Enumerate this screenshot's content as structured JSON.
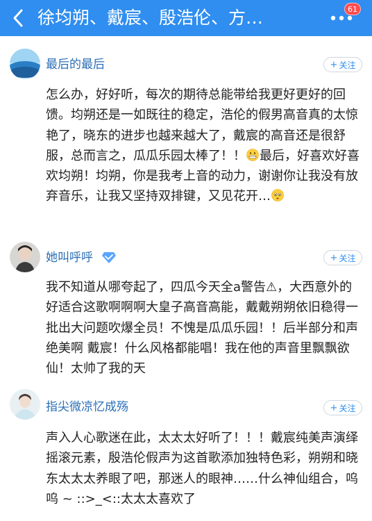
{
  "header": {
    "title": "徐均朔、戴宸、殷浩伦、方…",
    "badge_count": "61",
    "accent_color": "#2f8ef0",
    "back_icon": "chevron-left-icon",
    "more_icon": "more-dots-icon"
  },
  "comments": [
    {
      "username": "最后的最后",
      "follow_label": "关注",
      "text_before_emoji1": "怎么办，好好听，每次的期待总能带给我更好更好的回馈。均朔还是一如既往的稳定，浩伦的假男高音真的太惊艳了，晓东的进步也越来越大了，戴宸的高音还是很舒服，总而言之，瓜瓜乐园太棒了！！",
      "text_between_emojis": "最后，好喜欢好喜欢均朔！均朔，你是我考上音的动力，谢谢你让我没有放弃音乐，让我又坚持双排键，又见花开…",
      "emoji1": "grin-emoji",
      "emoji2": "tearful-emoji"
    },
    {
      "username": "她叫呼呼",
      "verified_icon": "verified-music-icon",
      "follow_label": "关注",
      "text": "我不知道从哪夸起了，四瓜今天全a警告⚠，大西意外的好适合这歌啊啊啊大皇子高音高能，戴戴朔朔依旧稳得一批出大问题吹爆全员！不愧是瓜瓜乐园！！后半部分和声绝美啊 戴宸！什么风格都能唱！我在他的声音里飘飘欲仙！太帅了我的天"
    },
    {
      "username": "指尖微凉忆成殇",
      "follow_label": "关注",
      "text": "声入人心歌迷在此，太太太好听了！！！戴宸纯美声演绎摇滚元素，殷浩伦假声为这首歌添加独特色彩，朔朔和晓东太太太养眼了吧，那迷人的眼神……什么神仙组合，呜呜 ~ ::>_<::太太太喜欢了"
    }
  ]
}
